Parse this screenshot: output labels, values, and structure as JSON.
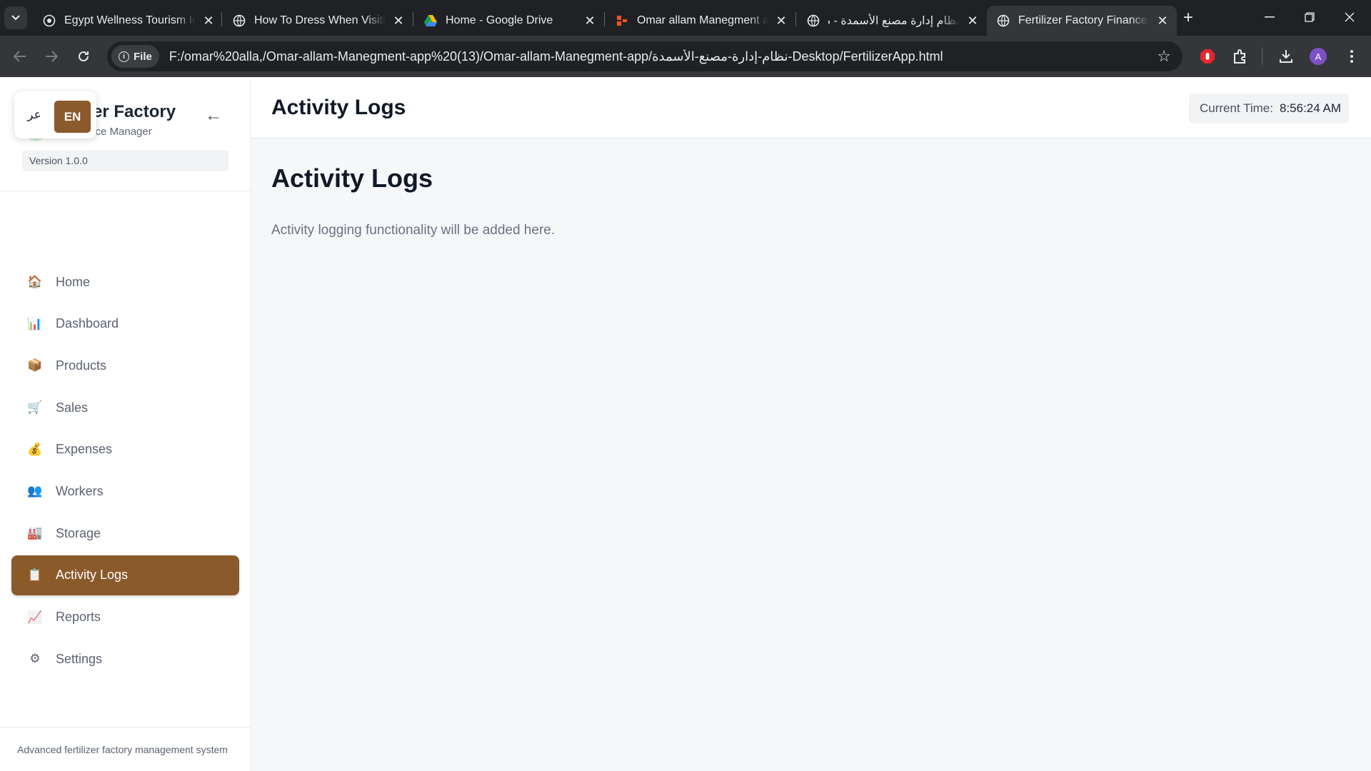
{
  "browser": {
    "tabs": [
      {
        "title": "Egypt Wellness Tourism Ide",
        "favicon": "globe-icon",
        "active": false
      },
      {
        "title": "How To Dress When Visitin",
        "favicon": "globe-icon",
        "active": false
      },
      {
        "title": "Home - Google Drive",
        "favicon": "google-drive-icon",
        "active": false
      },
      {
        "title": "Omar allam Manegment ap",
        "favicon": "app-icon",
        "active": false
      },
      {
        "title": "نظام إدارة مصنع الأسمدة - م",
        "favicon": "globe-icon",
        "active": false
      },
      {
        "title": "Fertilizer Factory Finance M",
        "favicon": "globe-icon",
        "active": true
      }
    ],
    "address": {
      "scheme_label": "File",
      "url": "F:/omar%20alla,/Omar-allam-Manegment-app%20(13)/Omar-allam-Manegment-app/نظام-إدارة-مصنع-الأسمدة-Desktop/FertilizerApp.html"
    },
    "profile_initial": "A"
  },
  "sidebar": {
    "brand_title": "tilizer Factory",
    "brand_subtitle": "Finance Manager",
    "version": "Version 1.0.0",
    "collapse_glyph": "←",
    "language": {
      "ar": "عر",
      "en": "EN",
      "selected": "EN"
    },
    "items": [
      {
        "label": "Home",
        "icon": "🏠",
        "icon_name": "home-icon"
      },
      {
        "label": "Dashboard",
        "icon": "📊",
        "icon_name": "bar-chart-icon"
      },
      {
        "label": "Products",
        "icon": "📦",
        "icon_name": "package-icon"
      },
      {
        "label": "Sales",
        "icon": "🛒",
        "icon_name": "shopping-cart-icon"
      },
      {
        "label": "Expenses",
        "icon": "💰",
        "icon_name": "money-bag-icon"
      },
      {
        "label": "Workers",
        "icon": "👥",
        "icon_name": "people-icon"
      },
      {
        "label": "Storage",
        "icon": "🏭",
        "icon_name": "factory-icon"
      },
      {
        "label": "Activity Logs",
        "icon": "📋",
        "icon_name": "clipboard-icon",
        "active": true
      },
      {
        "label": "Reports",
        "icon": "📈",
        "icon_name": "trend-chart-icon"
      },
      {
        "label": "Settings",
        "icon": "⚙",
        "icon_name": "gear-icon"
      }
    ],
    "footer": "Advanced fertilizer factory management system"
  },
  "header": {
    "title": "Activity Logs",
    "clock_label": "Current Time:",
    "clock_value": "8:56:24 AM"
  },
  "content": {
    "heading": "Activity Logs",
    "text": "Activity logging functionality will be added here."
  },
  "colors": {
    "accent": "#8b5a2b",
    "chrome_dark": "#202124",
    "chrome_tab": "#35363a"
  }
}
